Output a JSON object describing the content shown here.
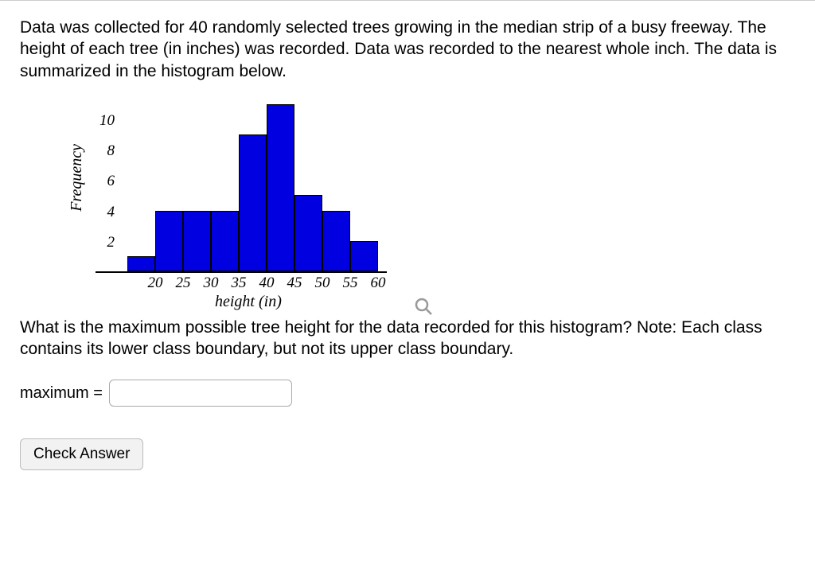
{
  "problem_text": "Data was collected for 40 randomly selected trees growing in the median strip of a busy freeway. The height of each tree (in inches) was recorded. Data was recorded to the nearest whole inch. The data is summarized in the histogram below.",
  "question_text": "What is the maximum possible tree height for the data recorded for this histogram? Note: Each class contains its lower class boundary, but not its upper class boundary.",
  "answer_label": "maximum =",
  "answer_value": "",
  "check_button_label": "Check Answer",
  "chart_data": {
    "type": "bar",
    "title": "",
    "xlabel": "height (in)",
    "ylabel": "Frequency",
    "ylim": [
      0,
      11
    ],
    "y_ticks": [
      2,
      4,
      6,
      8,
      10
    ],
    "x_ticks": [
      20,
      25,
      30,
      35,
      40,
      45,
      50,
      55,
      60
    ],
    "bin_edges": [
      15,
      20,
      25,
      30,
      35,
      40,
      45,
      50,
      55,
      60
    ],
    "values": [
      1,
      4,
      4,
      4,
      9,
      11,
      5,
      4,
      2
    ]
  }
}
